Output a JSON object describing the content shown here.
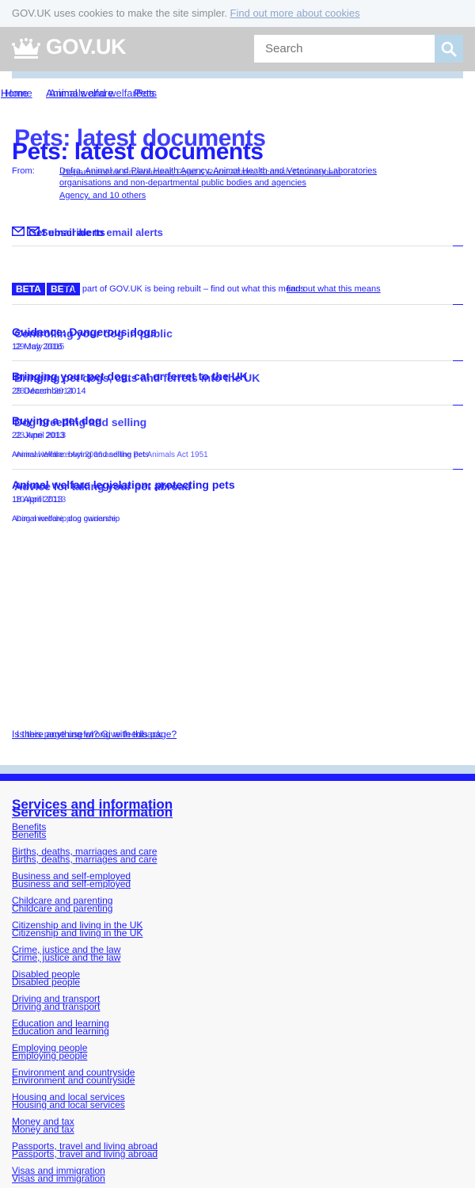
{
  "cookie_banner": {
    "text": "GOV.UK uses cookies to make the site simpler.",
    "link": "Find out more about cookies"
  },
  "header": {
    "logo": "GOV.UK",
    "search_placeholder": "Search"
  },
  "breadcrumbs": {
    "layer_a": [
      "Home",
      "Animal welfare",
      "Pets"
    ],
    "layer_b": [
      "Home",
      "Animals and welfare",
      "Pets"
    ]
  },
  "title": {
    "a": "Pets: latest documents",
    "b": "Pets: latest documents"
  },
  "from": {
    "label": "From:",
    "lines": [
      "Defra, Animal and Plant Health Agency, Animal Health and Veterinary Laboratories",
      "Agency, and 10 others",
      "Department for Environment, Food & Rural Affairs, Scottish Government",
      "organisations and non-departmental public bodies and agencies"
    ]
  },
  "alerts": {
    "a": "Get email alerts",
    "b": "Subscribe to email alerts"
  },
  "beta": {
    "badge": "BETA",
    "badge_b": "BETA",
    "text": "This part of GOV.UK is being rebuilt – find out what this means",
    "link": "find out what this means"
  },
  "documents": [
    {
      "title_a": "Guidance: Dangerous dogs",
      "title_b": "Controlling your dog in public",
      "date_a": "12 May 2016",
      "date_b": "29 July 2015"
    },
    {
      "title_a": "Bringing your pet dog, cat or ferret to the UK",
      "title_b": "Bringing pet dogs, cats and ferrets into the UK",
      "date_a": "29 December 2014",
      "date_b": "23 March 2014"
    },
    {
      "title_a": "Buying a pet dog",
      "title_b": "Dog breeding and selling",
      "date_a": "22 June 2013",
      "date_b": "23 April 2013",
      "desc_a": "Animal welfare: buying and selling pets",
      "desc_b": "Animal Welfare Act 2006 and the Pet Animals Act 1951"
    },
    {
      "title_a": "Animal welfare legislation: protecting pets",
      "title_b": "Advice for taking your pet abroad",
      "date_a": "18 April 2013",
      "date_b": "10 April 2013",
      "desc_a": "Animal welfare: dog ownership",
      "desc_b": "Dog microchipping guidance"
    }
  ],
  "feedback": {
    "a": "Is there anything wrong with this page?",
    "b": "Is this page useful? Give feedback"
  },
  "footer": {
    "heading": "Services and information",
    "links": [
      "Benefits",
      "Births, deaths, marriages and care",
      "Business and self-employed",
      "Childcare and parenting",
      "Citizenship and living in the UK",
      "Crime, justice and the law",
      "Disabled people",
      "Driving and transport",
      "Education and learning",
      "Employing people",
      "Environment and countryside",
      "Housing and local services",
      "Money and tax",
      "Passports, travel and living abroad",
      "Visas and immigration"
    ]
  },
  "colors": {
    "link": "#1d1dff",
    "header_bg": "#cbcbcb",
    "cookie_bg": "#f3f7fa",
    "footer_stripe": "#1d1dff"
  }
}
